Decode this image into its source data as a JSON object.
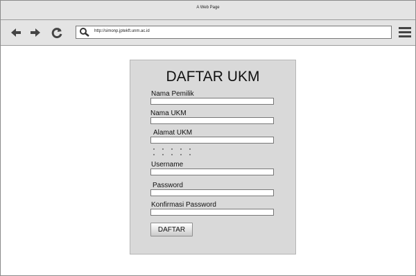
{
  "window": {
    "title": "A Web Page"
  },
  "toolbar": {
    "url": "http://simonp.jptekft.unm.ac.id",
    "icons": [
      "back-arrow-icon",
      "forward-arrow-icon",
      "reload-icon",
      "search-icon",
      "hamburger-menu-icon"
    ]
  },
  "form": {
    "title": "DAFTAR UKM",
    "fields": [
      {
        "label": "Nama Pemilik",
        "value": ""
      },
      {
        "label": "Nama UKM",
        "value": ""
      },
      {
        "label": "Alamat UKM",
        "value": ""
      },
      {
        "label": "Username",
        "value": ""
      },
      {
        "label": "Password",
        "value": ""
      },
      {
        "label": "Konfirmasi Password",
        "value": ""
      }
    ],
    "submit_label": "DAFTAR"
  },
  "colors": {
    "chrome": "#e4e4e4",
    "panel": "#d9d9d9",
    "border": "#777777"
  }
}
